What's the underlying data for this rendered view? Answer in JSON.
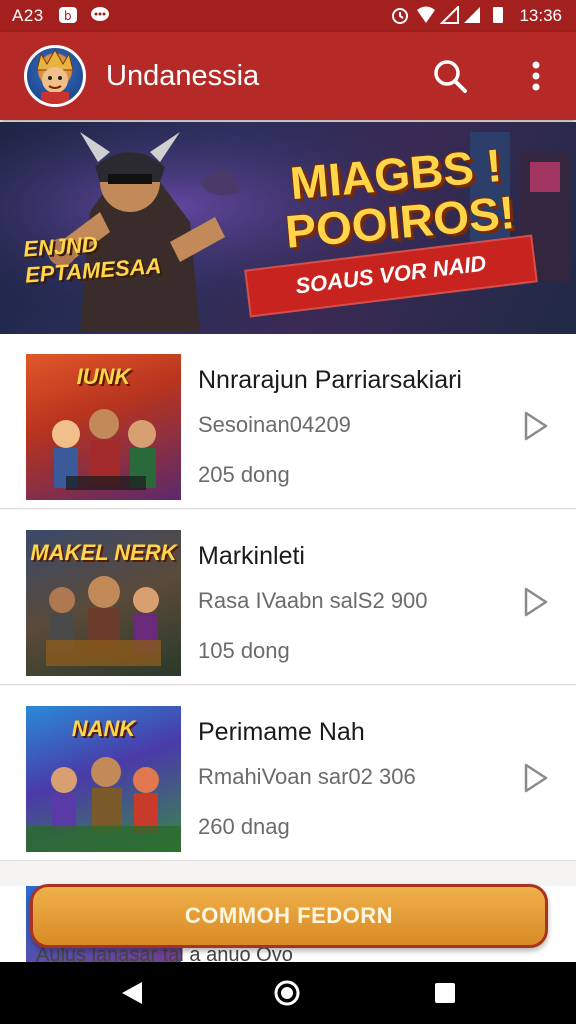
{
  "status_bar": {
    "time_left": "A23",
    "time_right": "13:36",
    "icons": [
      "b-icon",
      "message-icon",
      "alarm-icon",
      "wifi-icon",
      "signal-icon",
      "signal-icon",
      "battery-icon"
    ]
  },
  "app_bar": {
    "title": "Undanessia",
    "search_icon": "search-icon",
    "more_icon": "more-vertical-icon"
  },
  "banner": {
    "headline": "MIAGBS ! POOIROS!",
    "subtitle": "SOAUS VOR NAID",
    "left_title": "ENJND EPTAMESAA"
  },
  "items": [
    {
      "thumb_title": "IUNK",
      "title": "Nnrarajun Parriarsakiari",
      "subtitle": "Sesoinan04209",
      "count": "205 dong"
    },
    {
      "thumb_title": "MAKEL NERK",
      "title": "Markinleti",
      "subtitle": "Rasa IVaabn salS2 900",
      "count": "105 dong"
    },
    {
      "thumb_title": "NANK",
      "title": "Perimame Nah",
      "subtitle": "RmahiVoan sar02 306",
      "count": "260 dnag"
    }
  ],
  "cta": {
    "label": "COMMOH FEDORN"
  },
  "partial_item": {
    "text": "Aulus lanasar tal a anuo Ovo"
  },
  "colors": {
    "primary": "#b52a26",
    "status": "#a3201f",
    "cta": "#e09a32"
  }
}
